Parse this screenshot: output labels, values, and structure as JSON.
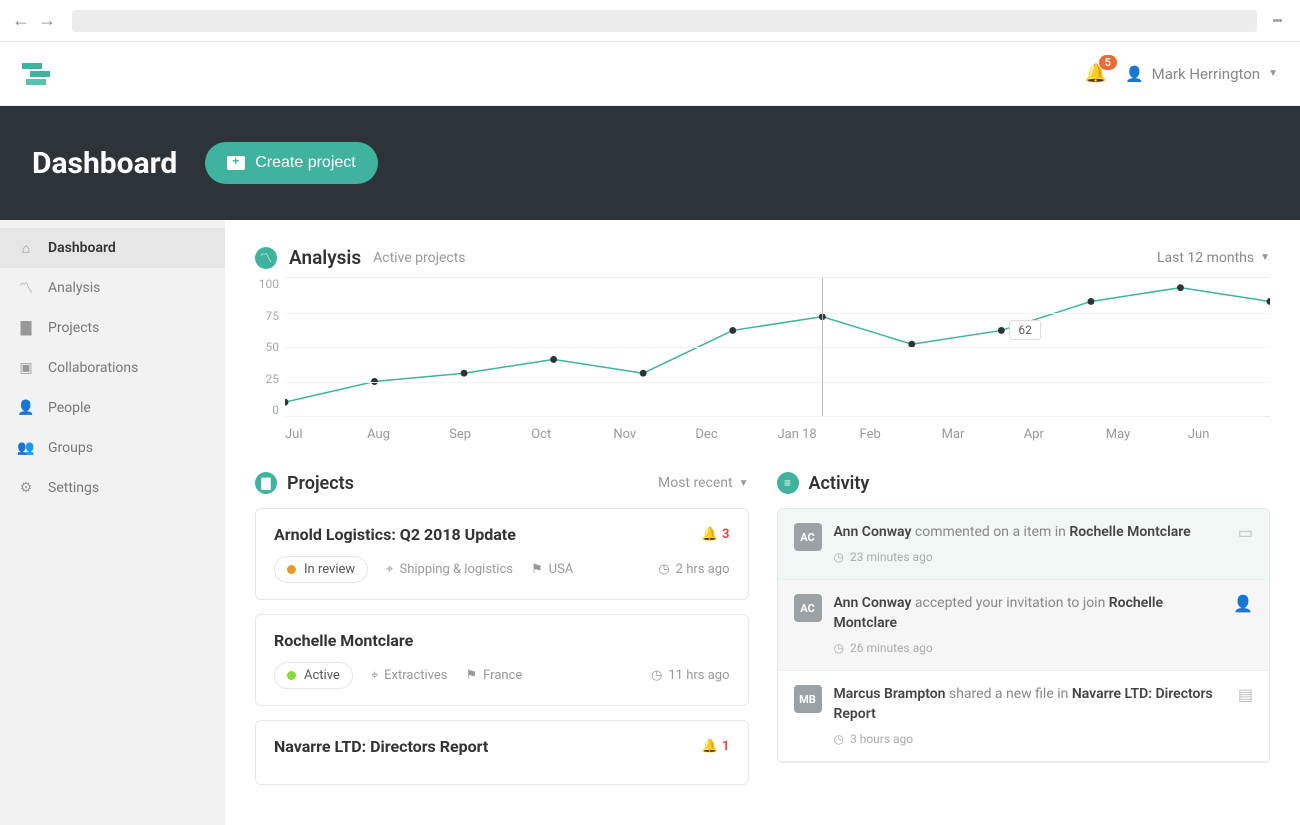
{
  "header": {
    "notifications_badge": "5",
    "user_name": "Mark Herrington"
  },
  "hero": {
    "title": "Dashboard",
    "create_button": "Create project"
  },
  "sidebar": {
    "items": [
      {
        "label": "Dashboard",
        "icon": "home-icon"
      },
      {
        "label": "Analysis",
        "icon": "trend-icon"
      },
      {
        "label": "Projects",
        "icon": "folder-icon"
      },
      {
        "label": "Collaborations",
        "icon": "chat-icon"
      },
      {
        "label": "People",
        "icon": "person-icon"
      },
      {
        "label": "Groups",
        "icon": "people-icon"
      },
      {
        "label": "Settings",
        "icon": "gear-icon"
      }
    ]
  },
  "analysis": {
    "title": "Analysis",
    "subtitle": "Active projects",
    "range_label": "Last 12 months",
    "tooltip_value": "62"
  },
  "chart_data": {
    "type": "line",
    "title": "Active projects",
    "xlabel": "",
    "ylabel": "",
    "ylim": [
      0,
      100
    ],
    "yticks": [
      0,
      25,
      50,
      75,
      100
    ],
    "categories": [
      "Jul",
      "Aug",
      "Sep",
      "Oct",
      "Nov",
      "Dec",
      "Jan 18",
      "Feb",
      "Mar",
      "Apr",
      "May",
      "Jun"
    ],
    "values": [
      10,
      25,
      31,
      41,
      31,
      62,
      72,
      52,
      62,
      83,
      93,
      83
    ],
    "highlight_index": 8,
    "highlight_value": 62,
    "vline_index": 6
  },
  "projects": {
    "title": "Projects",
    "sort_label": "Most recent",
    "items": [
      {
        "title": "Arnold Logistics: Q2 2018 Update",
        "alerts": "3",
        "status": "In review",
        "status_color": "#e79a2a",
        "category": "Shipping & logistics",
        "country": "USA",
        "time": "2 hrs ago"
      },
      {
        "title": "Rochelle Montclare",
        "alerts": "",
        "status": "Active",
        "status_color": "#8ada3a",
        "category": "Extractives",
        "country": "France",
        "time": "11 hrs ago"
      },
      {
        "title": "Navarre LTD: Directors Report",
        "alerts": "1",
        "status": "",
        "status_color": "",
        "category": "",
        "country": "",
        "time": ""
      }
    ]
  },
  "activity": {
    "title": "Activity",
    "items": [
      {
        "initials": "AC",
        "who": "Ann Conway",
        "action": "commented on a item in",
        "what": "Rochelle Montclare",
        "time": "23 minutes ago",
        "icon": "comment-icon",
        "style": "highlight"
      },
      {
        "initials": "AC",
        "who": "Ann Conway",
        "action": "accepted your invitation to join",
        "what": "Rochelle Montclare",
        "time": "26 minutes ago",
        "icon": "person-add-icon",
        "style": "mute"
      },
      {
        "initials": "MB",
        "who": "Marcus Brampton",
        "action": "shared a new file in",
        "what": "Navarre LTD: Directors Report",
        "time": "3 hours ago",
        "icon": "file-icon",
        "style": ""
      }
    ]
  }
}
